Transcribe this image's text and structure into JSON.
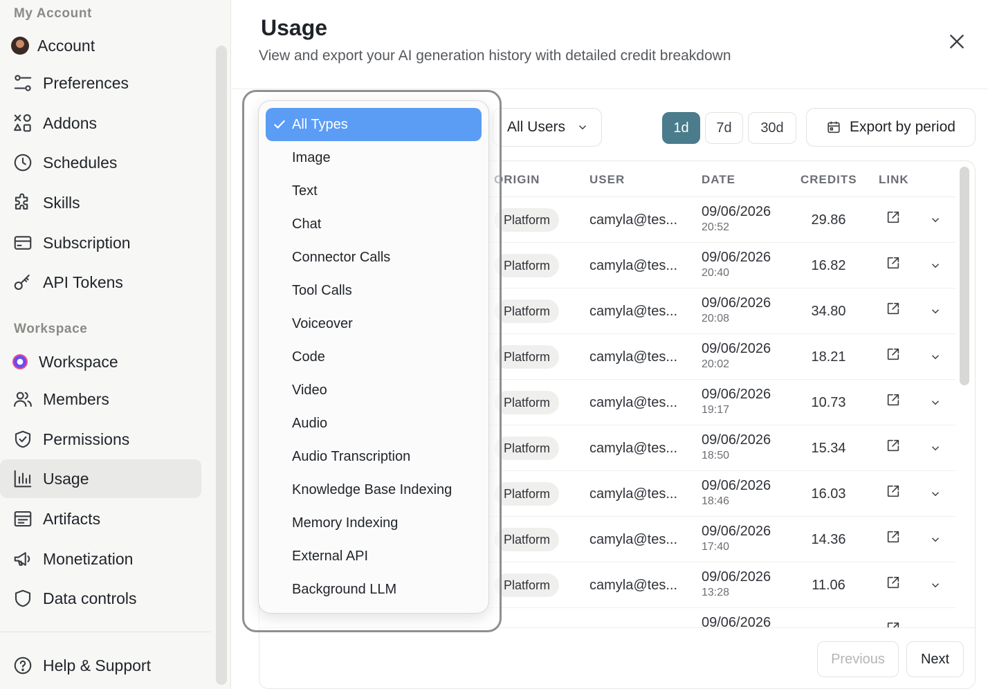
{
  "sidebar": {
    "section_account": "My Account",
    "section_workspace": "Workspace",
    "items": [
      {
        "label": "Account",
        "icon": "avatar"
      },
      {
        "label": "Preferences",
        "icon": "sliders-icon"
      },
      {
        "label": "Addons",
        "icon": "shapes-icon"
      },
      {
        "label": "Schedules",
        "icon": "clock-icon"
      },
      {
        "label": "Skills",
        "icon": "puzzle-icon"
      },
      {
        "label": "Subscription",
        "icon": "card-icon"
      },
      {
        "label": "API Tokens",
        "icon": "key-icon"
      },
      {
        "label": "Workspace",
        "icon": "workspace-logo"
      },
      {
        "label": "Members",
        "icon": "users-icon"
      },
      {
        "label": "Permissions",
        "icon": "shield-check-icon"
      },
      {
        "label": "Usage",
        "icon": "bar-chart-icon",
        "active": true
      },
      {
        "label": "Artifacts",
        "icon": "artifact-icon"
      },
      {
        "label": "Monetization",
        "icon": "megaphone-icon"
      },
      {
        "label": "Data controls",
        "icon": "shield-icon"
      },
      {
        "label": "Help & Support",
        "icon": "help-icon"
      }
    ]
  },
  "header": {
    "title": "Usage",
    "subtitle": "View and export your AI generation history with detailed credit breakdown"
  },
  "filters": {
    "type_options": [
      "All Types",
      "Image",
      "Text",
      "Chat",
      "Connector Calls",
      "Tool Calls",
      "Voiceover",
      "Code",
      "Video",
      "Audio",
      "Audio Transcription",
      "Knowledge Base Indexing",
      "Memory Indexing",
      "External API",
      "Background LLM"
    ],
    "type_selected": "All Types",
    "users_selected": "All Users",
    "periods": [
      "1d",
      "7d",
      "30d"
    ],
    "period_active": "1d",
    "export_label": "Export by period"
  },
  "table": {
    "columns": [
      "ORIGIN",
      "USER",
      "DATE",
      "CREDITS",
      "LINK"
    ],
    "rows": [
      {
        "origin": "Platform",
        "user": "camyla@tes...",
        "date": "09/06/2026",
        "time": "20:52",
        "credits": "29.86"
      },
      {
        "origin": "Platform",
        "user": "camyla@tes...",
        "date": "09/06/2026",
        "time": "20:40",
        "credits": "16.82"
      },
      {
        "origin": "Platform",
        "user": "camyla@tes...",
        "date": "09/06/2026",
        "time": "20:08",
        "credits": "34.80"
      },
      {
        "origin": "Platform",
        "user": "camyla@tes...",
        "date": "09/06/2026",
        "time": "20:02",
        "credits": "18.21"
      },
      {
        "origin": "Platform",
        "user": "camyla@tes...",
        "date": "09/06/2026",
        "time": "19:17",
        "credits": "10.73"
      },
      {
        "origin": "Platform",
        "user": "camyla@tes...",
        "date": "09/06/2026",
        "time": "18:50",
        "credits": "15.34"
      },
      {
        "origin": "Platform",
        "user": "camyla@tes...",
        "date": "09/06/2026",
        "time": "18:46",
        "credits": "16.03"
      },
      {
        "origin": "Platform",
        "user": "camyla@tes...",
        "date": "09/06/2026",
        "time": "17:40",
        "credits": "14.36"
      },
      {
        "origin": "Platform",
        "user": "camyla@tes...",
        "date": "09/06/2026",
        "time": "13:28",
        "credits": "11.06"
      },
      {
        "origin": "",
        "user": "",
        "date": "09/06/2026",
        "time": "",
        "credits": ""
      }
    ]
  },
  "pagination": {
    "previous_label": "Previous",
    "next_label": "Next"
  },
  "colors": {
    "accent": "#4a7c8c",
    "selected_option": "#5b9cf5"
  }
}
